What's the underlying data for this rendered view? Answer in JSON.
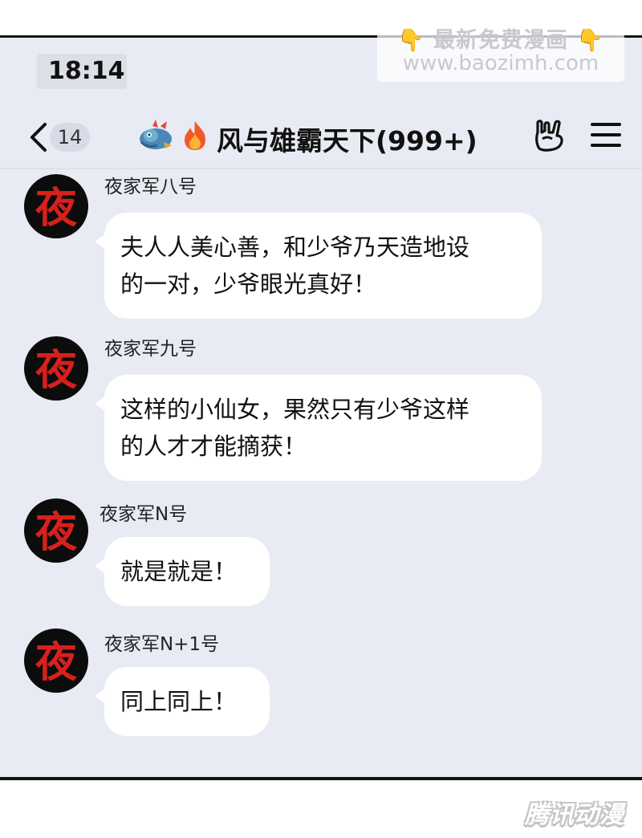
{
  "status_bar": {
    "time": "18:14"
  },
  "watermark": {
    "line1": "最新免费漫画",
    "line2": "www.baozimh.com",
    "hand_left": "👇",
    "hand_right": "👇"
  },
  "nav": {
    "unread_count": "14",
    "title": "风与雄霸天下(999+)",
    "group_icon": "dragon-icon",
    "fire_icon": "fire-icon"
  },
  "messages": [
    {
      "sender": "夜家军八号",
      "lines": [
        "夫人人美心善，和少爷乃天造地设",
        "的一对，少爷眼光真好！"
      ]
    },
    {
      "sender": "夜家军九号",
      "lines": [
        "这样的小仙女，果然只有少爷这样",
        "的人才才能摘获！"
      ]
    },
    {
      "sender": "夜家军N号",
      "lines": [
        "就是就是！"
      ]
    },
    {
      "sender": "夜家军N+1号",
      "lines": [
        "同上同上！"
      ]
    }
  ],
  "avatar_text": "夜",
  "footer": {
    "brand": "腾讯动漫"
  },
  "colors": {
    "background": "#e9ebf4",
    "bubble": "#ffffff",
    "avatar_bg": "#0c0c0c",
    "avatar_glyph": "#d8201c"
  }
}
